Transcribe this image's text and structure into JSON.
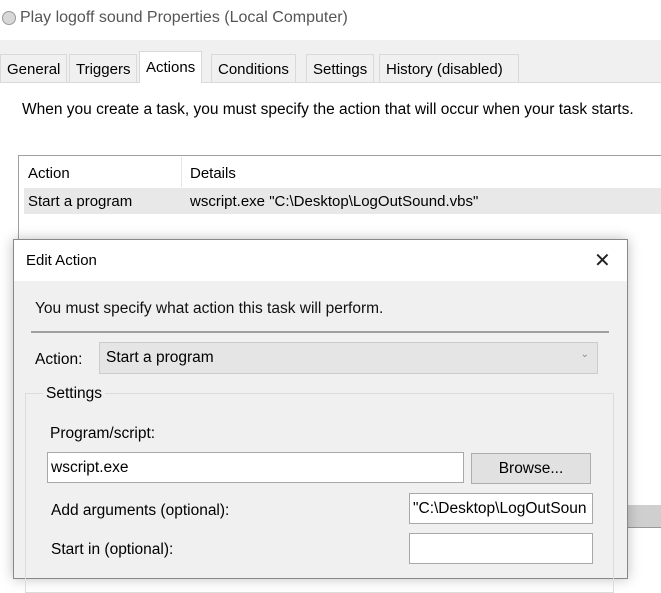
{
  "window": {
    "title": "Play logoff sound Properties (Local Computer)",
    "icon": "task-scheduler-clock-icon"
  },
  "tabs": [
    {
      "label": "General"
    },
    {
      "label": "Triggers"
    },
    {
      "label": "Actions",
      "active": true
    },
    {
      "label": "Conditions"
    },
    {
      "label": "Settings"
    },
    {
      "label": "History (disabled)"
    }
  ],
  "actions_tab": {
    "intro": "When you create a task, you must specify the action that will occur when your task starts.",
    "columns": [
      "Action",
      "Details"
    ],
    "rows": [
      {
        "action": "Start a program",
        "details": "wscript.exe \"C:\\Desktop\\LogOutSound.vbs\""
      }
    ]
  },
  "edit_action": {
    "title": "Edit Action",
    "close_icon": "close-icon",
    "intro": "You must specify what action this task will perform.",
    "action_label": "Action:",
    "action_value": "Start a program",
    "settings_label": "Settings",
    "program_label": "Program/script:",
    "program_value": "wscript.exe",
    "browse_label": "Browse...",
    "arguments_label": "Add arguments (optional):",
    "arguments_value": "\"C:\\Desktop\\LogOutSoun",
    "start_in_label": "Start in (optional):",
    "start_in_value": ""
  }
}
